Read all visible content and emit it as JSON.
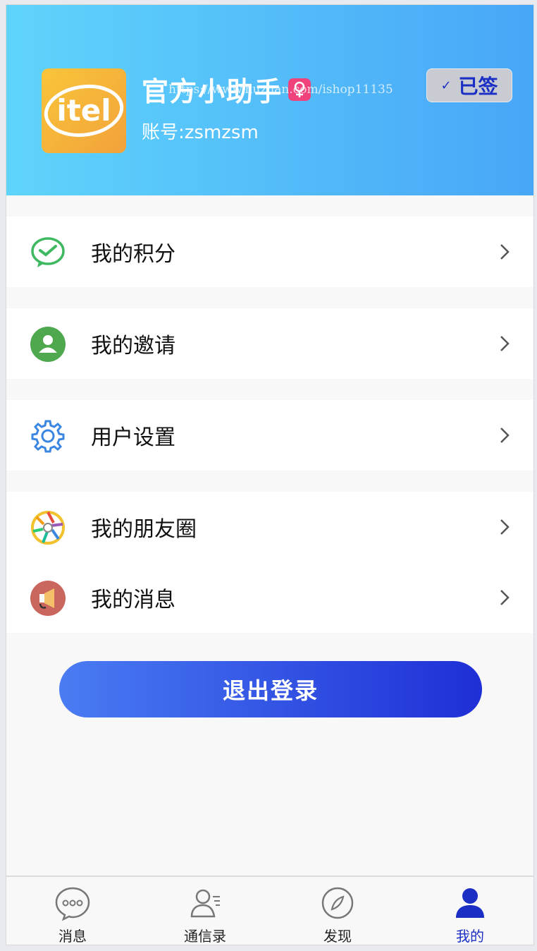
{
  "profile": {
    "name": "官方小助手",
    "account": "账号:zsmzsm",
    "watermark": "https://www.huzhan.com/ishop11135",
    "sign_label": "已签",
    "avatar_text": "itel",
    "accent": "#48a6f7"
  },
  "menu_groups": [
    [
      {
        "label": "我的积分",
        "icon": "wechat-check-icon"
      }
    ],
    [
      {
        "label": "我的邀请",
        "icon": "invite-user-icon"
      }
    ],
    [
      {
        "label": "用户设置",
        "icon": "gear-icon"
      }
    ],
    [
      {
        "label": "我的朋友圈",
        "icon": "aperture-icon"
      },
      {
        "label": "我的消息",
        "icon": "megaphone-icon"
      }
    ]
  ],
  "logout_label": "退出登录",
  "tabs": [
    {
      "label": "消息",
      "icon": "chat-bubble-icon",
      "active": false
    },
    {
      "label": "通信录",
      "icon": "contacts-icon",
      "active": false
    },
    {
      "label": "发现",
      "icon": "compass-icon",
      "active": false
    },
    {
      "label": "我的",
      "icon": "user-icon",
      "active": true
    }
  ],
  "colors": {
    "active": "#1b2fc4",
    "button_start": "#4a7cf3",
    "button_end": "#1e2fd6"
  }
}
